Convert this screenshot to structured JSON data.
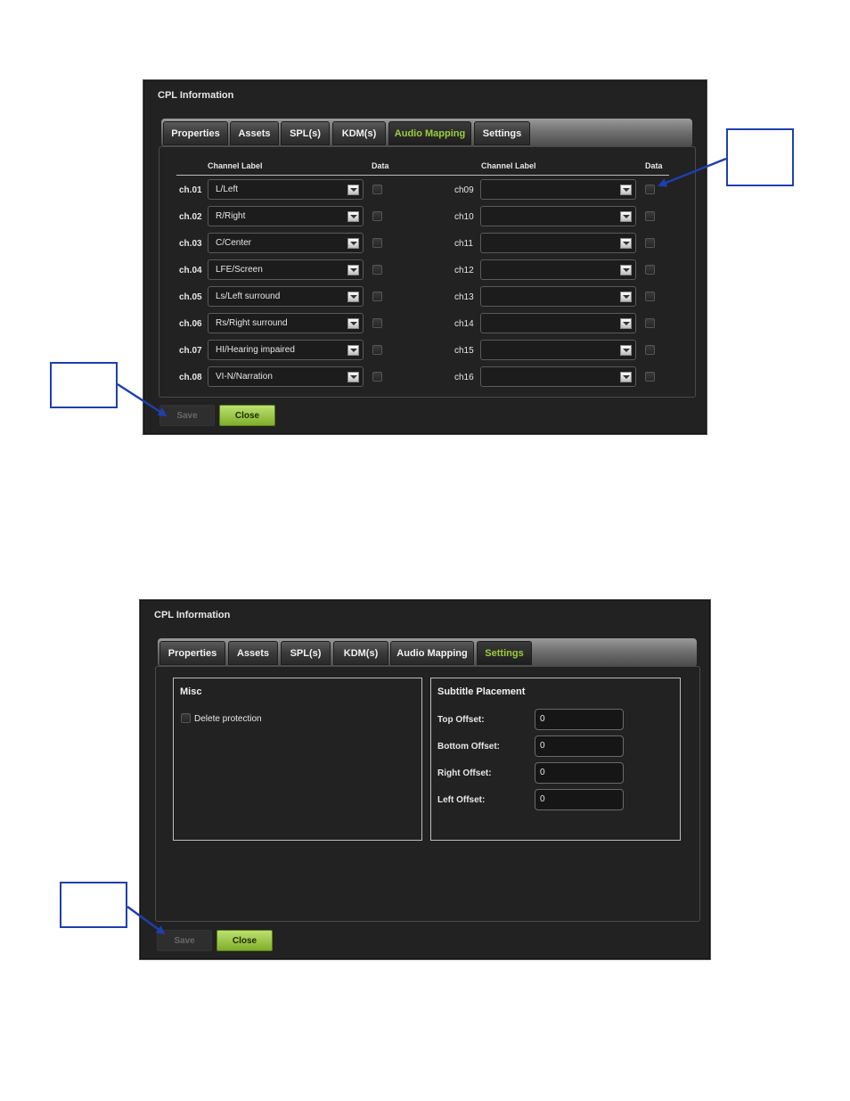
{
  "window1": {
    "title": "CPL Information",
    "tabs": [
      "Properties",
      "Assets",
      "SPL(s)",
      "KDM(s)",
      "Audio Mapping",
      "Settings"
    ],
    "active_tab": "Audio Mapping",
    "columns": {
      "channel_label": "Channel Label",
      "data": "Data"
    },
    "left_channels": [
      {
        "ch": "ch.01",
        "value": "L/Left"
      },
      {
        "ch": "ch.02",
        "value": "R/Right"
      },
      {
        "ch": "ch.03",
        "value": "C/Center"
      },
      {
        "ch": "ch.04",
        "value": "LFE/Screen"
      },
      {
        "ch": "ch.05",
        "value": "Ls/Left surround"
      },
      {
        "ch": "ch.06",
        "value": "Rs/Right surround"
      },
      {
        "ch": "ch.07",
        "value": "HI/Hearing impaired"
      },
      {
        "ch": "ch.08",
        "value": "VI-N/Narration"
      }
    ],
    "right_channels": [
      {
        "ch": "ch09",
        "value": ""
      },
      {
        "ch": "ch10",
        "value": ""
      },
      {
        "ch": "ch11",
        "value": ""
      },
      {
        "ch": "ch12",
        "value": ""
      },
      {
        "ch": "ch13",
        "value": ""
      },
      {
        "ch": "ch14",
        "value": ""
      },
      {
        "ch": "ch15",
        "value": ""
      },
      {
        "ch": "ch16",
        "value": ""
      }
    ],
    "save_label": "Save",
    "close_label": "Close"
  },
  "window2": {
    "title": "CPL Information",
    "tabs": [
      "Properties",
      "Assets",
      "SPL(s)",
      "KDM(s)",
      "Audio Mapping",
      "Settings"
    ],
    "active_tab": "Settings",
    "misc": {
      "title": "Misc",
      "delete_protection": "Delete protection"
    },
    "subtitle": {
      "title": "Subtitle Placement",
      "fields": [
        {
          "label": "Top Offset:",
          "value": "0"
        },
        {
          "label": "Bottom Offset:",
          "value": "0"
        },
        {
          "label": "Right Offset:",
          "value": "0"
        },
        {
          "label": "Left Offset:",
          "value": "0"
        }
      ]
    },
    "save_label": "Save",
    "close_label": "Close"
  },
  "colors": {
    "accent_green": "#9ccc3c",
    "callout_blue": "#1f3fae",
    "window_bg": "#222222"
  }
}
